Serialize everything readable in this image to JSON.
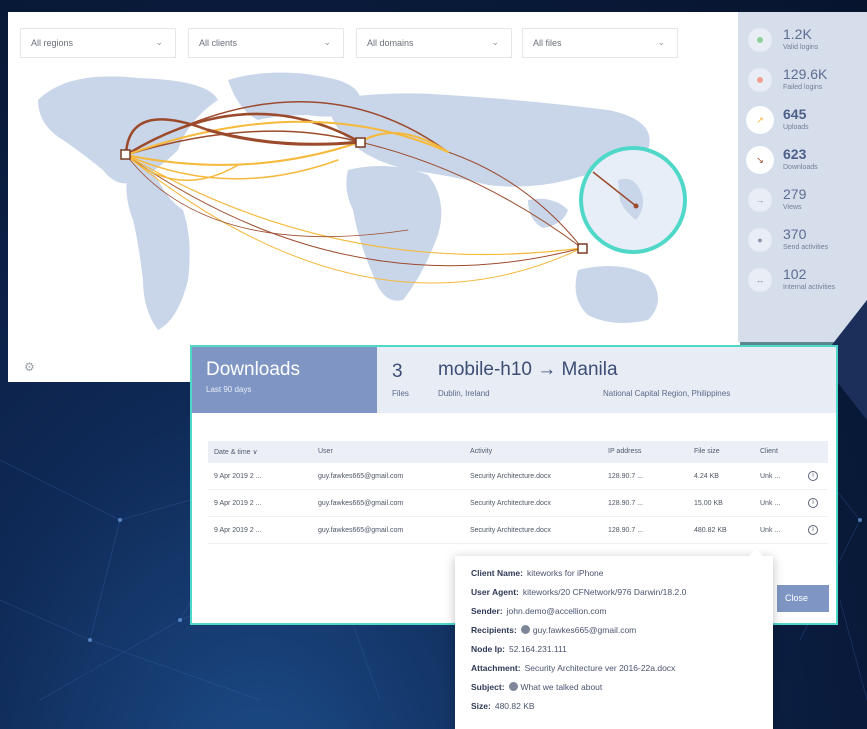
{
  "filters": [
    {
      "label": "All regions"
    },
    {
      "label": "All clients"
    },
    {
      "label": "All domains"
    },
    {
      "label": "All files"
    }
  ],
  "stats": [
    {
      "value": "1.2K",
      "label": "Valid logins",
      "icon": "login-success-icon"
    },
    {
      "value": "129.6K",
      "label": "Failed logins",
      "icon": "login-failed-icon"
    },
    {
      "value": "645",
      "label": "Uploads",
      "icon": "upload-icon"
    },
    {
      "value": "623",
      "label": "Downloads",
      "icon": "download-icon"
    },
    {
      "value": "279",
      "label": "Views",
      "icon": "view-icon"
    },
    {
      "value": "370",
      "label": "Send activities",
      "icon": "send-icon"
    },
    {
      "value": "102",
      "label": "Internal activities",
      "icon": "internal-icon"
    }
  ],
  "card": {
    "title": "Downloads",
    "subtitle": "Last 90 days",
    "count": "3",
    "count_label": "Files",
    "route": "mobile-h10 → Manila",
    "from_location": "Dublin, Ireland",
    "to_location": "National Capital Region, Philippines",
    "close_label": "Close"
  },
  "table": {
    "columns": [
      "Date & time ∨",
      "User",
      "Activity",
      "IP address",
      "File size",
      "Client"
    ],
    "rows": [
      [
        "9 Apr 2019 2 ...",
        "guy.fawkes665@gmail.com",
        "Security Architecture.docx",
        "128.90.7 ...",
        "4.24 KB",
        "Unk ..."
      ],
      [
        "9 Apr 2019 2 ...",
        "guy.fawkes665@gmail.com",
        "Security Architecture.docx",
        "128.90.7 ...",
        "15.00 KB",
        "Unk ..."
      ],
      [
        "9 Apr 2019 2 ...",
        "guy.fawkes665@gmail.com",
        "Security Architecture.docx",
        "128.90.7 ...",
        "480.82 KB",
        "Unk ..."
      ]
    ]
  },
  "tooltip": {
    "client_name_label": "Client Name:",
    "client_name": "kiteworks for iPhone",
    "user_agent_label": "User Agent:",
    "user_agent": "kiteworks/20 CFNetwork/976 Darwin/18.2.0",
    "sender_label": "Sender:",
    "sender": "john.demo@accellion.com",
    "recipients_label": "Recipients:",
    "recipients": "guy.fawkes665@gmail.com",
    "node_ip_label": "Node Ip:",
    "node_ip": "52.164.231.111",
    "attachment_label": "Attachment:",
    "attachment": "Security Architecture ver 2016-22a.docx",
    "subject_label": "Subject:",
    "subject": "What we talked about",
    "size_label": "Size:",
    "size": "480.82 KB"
  },
  "colors": {
    "accent": "#7f96c4",
    "teal": "#4fd8c8",
    "arc_brown": "#9c4a2c",
    "arc_yellow": "#f5b93c"
  }
}
